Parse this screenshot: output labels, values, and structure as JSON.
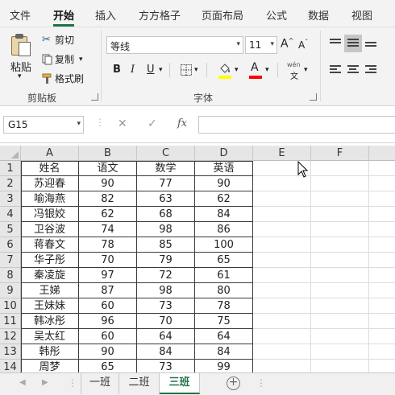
{
  "ribbon_tabs": [
    {
      "label": "文件",
      "active": false
    },
    {
      "label": "开始",
      "active": true
    },
    {
      "label": "插入",
      "active": false
    },
    {
      "label": "方方格子",
      "active": false
    },
    {
      "label": "页面布局",
      "active": false
    },
    {
      "label": "公式",
      "active": false
    },
    {
      "label": "数据",
      "active": false
    },
    {
      "label": "视图",
      "active": false
    }
  ],
  "clipboard": {
    "paste_label": "粘贴",
    "cut_label": "剪切",
    "copy_label": "复制",
    "format_painter_label": "格式刷",
    "group_label": "剪贴板"
  },
  "font": {
    "font_name": "等线",
    "font_size": "11",
    "grow_label": "A",
    "shrink_label": "A",
    "bold_label": "B",
    "italic_label": "I",
    "underline_label": "U",
    "phonetic_label": "wén",
    "phonetic_sub": "文",
    "font_color_label": "A",
    "group_label": "字体",
    "highlight_color": "#ffff00",
    "font_color": "#ff0000"
  },
  "formula_bar": {
    "name_box": "G15",
    "fx_label": "fx",
    "formula": ""
  },
  "grid": {
    "columns": [
      "A",
      "B",
      "C",
      "D",
      "E",
      "F"
    ],
    "row_numbers": [
      "1",
      "2",
      "3",
      "4",
      "5",
      "6",
      "7",
      "8",
      "9",
      "10",
      "11",
      "12",
      "13",
      "14"
    ],
    "headers": [
      "姓名",
      "语文",
      "数学",
      "英语"
    ],
    "rows": [
      [
        "苏迎春",
        "90",
        "77",
        "90"
      ],
      [
        "喻海燕",
        "82",
        "63",
        "62"
      ],
      [
        "冯银姣",
        "62",
        "68",
        "84"
      ],
      [
        "卫谷波",
        "74",
        "98",
        "86"
      ],
      [
        "蒋春文",
        "78",
        "85",
        "100"
      ],
      [
        "华子彤",
        "70",
        "79",
        "65"
      ],
      [
        "秦凌旋",
        "97",
        "72",
        "61"
      ],
      [
        "王娣",
        "87",
        "98",
        "80"
      ],
      [
        "王妹妹",
        "60",
        "73",
        "78"
      ],
      [
        "韩冰彤",
        "96",
        "70",
        "75"
      ],
      [
        "吴太红",
        "60",
        "64",
        "64"
      ],
      [
        "韩彤",
        "90",
        "84",
        "84"
      ],
      [
        "周梦",
        "65",
        "73",
        "99"
      ]
    ]
  },
  "sheets": [
    {
      "label": "一班",
      "active": false
    },
    {
      "label": "二班",
      "active": false
    },
    {
      "label": "三班",
      "active": true
    }
  ],
  "colors": {
    "accent": "#217346"
  }
}
